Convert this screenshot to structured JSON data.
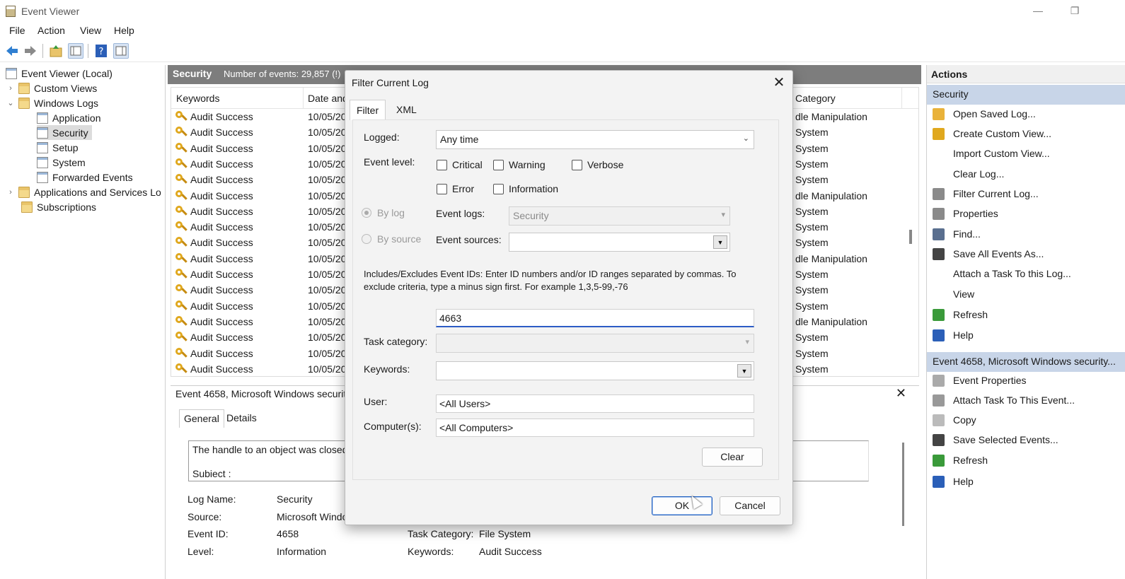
{
  "window": {
    "title": "Event Viewer",
    "controls": {
      "minimize": "—",
      "restore": "❐"
    }
  },
  "menu": [
    "File",
    "Action",
    "View",
    "Help"
  ],
  "tree": {
    "root": "Event Viewer (Local)",
    "custom_views": "Custom Views",
    "windows_logs": "Windows Logs",
    "logs": [
      "Application",
      "Security",
      "Setup",
      "System",
      "Forwarded Events"
    ],
    "apps_services": "Applications and Services Lo",
    "subscriptions": "Subscriptions"
  },
  "center": {
    "log_name": "Security",
    "event_count": "Number of events: 29,857 (!)",
    "columns": {
      "keywords": "Keywords",
      "date": "Date and",
      "category": "Category"
    },
    "rows": [
      {
        "keywords": "Audit Success",
        "date": "10/05/20",
        "category": "dle Manipulation"
      },
      {
        "keywords": "Audit Success",
        "date": "10/05/20",
        "category": "System"
      },
      {
        "keywords": "Audit Success",
        "date": "10/05/20",
        "category": "System"
      },
      {
        "keywords": "Audit Success",
        "date": "10/05/20",
        "category": "System"
      },
      {
        "keywords": "Audit Success",
        "date": "10/05/20",
        "category": "System"
      },
      {
        "keywords": "Audit Success",
        "date": "10/05/20",
        "category": "dle Manipulation"
      },
      {
        "keywords": "Audit Success",
        "date": "10/05/20",
        "category": "System"
      },
      {
        "keywords": "Audit Success",
        "date": "10/05/20",
        "category": "System"
      },
      {
        "keywords": "Audit Success",
        "date": "10/05/20",
        "category": "System"
      },
      {
        "keywords": "Audit Success",
        "date": "10/05/20",
        "category": "dle Manipulation"
      },
      {
        "keywords": "Audit Success",
        "date": "10/05/20",
        "category": "System"
      },
      {
        "keywords": "Audit Success",
        "date": "10/05/20",
        "category": "System"
      },
      {
        "keywords": "Audit Success",
        "date": "10/05/20",
        "category": "System"
      },
      {
        "keywords": "Audit Success",
        "date": "10/05/20",
        "category": "dle Manipulation"
      },
      {
        "keywords": "Audit Success",
        "date": "10/05/20",
        "category": "System"
      },
      {
        "keywords": "Audit Success",
        "date": "10/05/20",
        "category": "System"
      },
      {
        "keywords": "Audit Success",
        "date": "10/05/20",
        "category": "System"
      }
    ]
  },
  "detail": {
    "title": "Event 4658, Microsoft Windows securit",
    "close": "✕",
    "tabs": [
      "General",
      "Details"
    ],
    "message_line1": "The handle to an object was closed",
    "message_line2": "Subiect :",
    "fields": {
      "log_name_label": "Log Name:",
      "log_name": "Security",
      "source_label": "Source:",
      "source": "Microsoft Windo",
      "event_id_label": "Event ID:",
      "event_id": "4658",
      "level_label": "Level:",
      "level": "Information",
      "task_category_label": "Task Category:",
      "task_category": "File System",
      "keywords_label": "Keywords:",
      "keywords": "Audit Success"
    }
  },
  "actions": {
    "header": "Actions",
    "section1": "Security",
    "items1": [
      "Open Saved Log...",
      "Create Custom View...",
      "Import Custom View...",
      "Clear Log...",
      "Filter Current Log...",
      "Properties",
      "Find...",
      "Save All Events As...",
      "Attach a Task To this Log...",
      "View",
      "Refresh",
      "Help"
    ],
    "section2": "Event 4658, Microsoft Windows security...",
    "items2": [
      "Event Properties",
      "Attach Task To This Event...",
      "Copy",
      "Save Selected Events...",
      "Refresh",
      "Help"
    ]
  },
  "dialog": {
    "title": "Filter Current Log",
    "close": "✕",
    "tabs": [
      "Filter",
      "XML"
    ],
    "logged_label": "Logged:",
    "logged_value": "Any time",
    "event_level_label": "Event level:",
    "levels": {
      "critical": "Critical",
      "warning": "Warning",
      "verbose": "Verbose",
      "error": "Error",
      "information": "Information"
    },
    "by_log": "By log",
    "by_source": "By source",
    "event_logs_label": "Event logs:",
    "event_logs_value": "Security",
    "event_sources_label": "Event sources:",
    "event_sources_value": "",
    "ids_description": "Includes/Excludes Event IDs: Enter ID numbers and/or ID ranges separated by commas. To exclude criteria, type a minus sign first. For example 1,3,5-99,-76",
    "event_ids_value": "4663",
    "task_category_label": "Task category:",
    "task_category_value": "",
    "keywords_label": "Keywords:",
    "keywords_value": "",
    "user_label": "User:",
    "user_value": "<All Users>",
    "computers_label": "Computer(s):",
    "computers_value": "<All Computers>",
    "clear_button": "Clear",
    "ok_button": "OK",
    "cancel_button": "Cancel"
  }
}
